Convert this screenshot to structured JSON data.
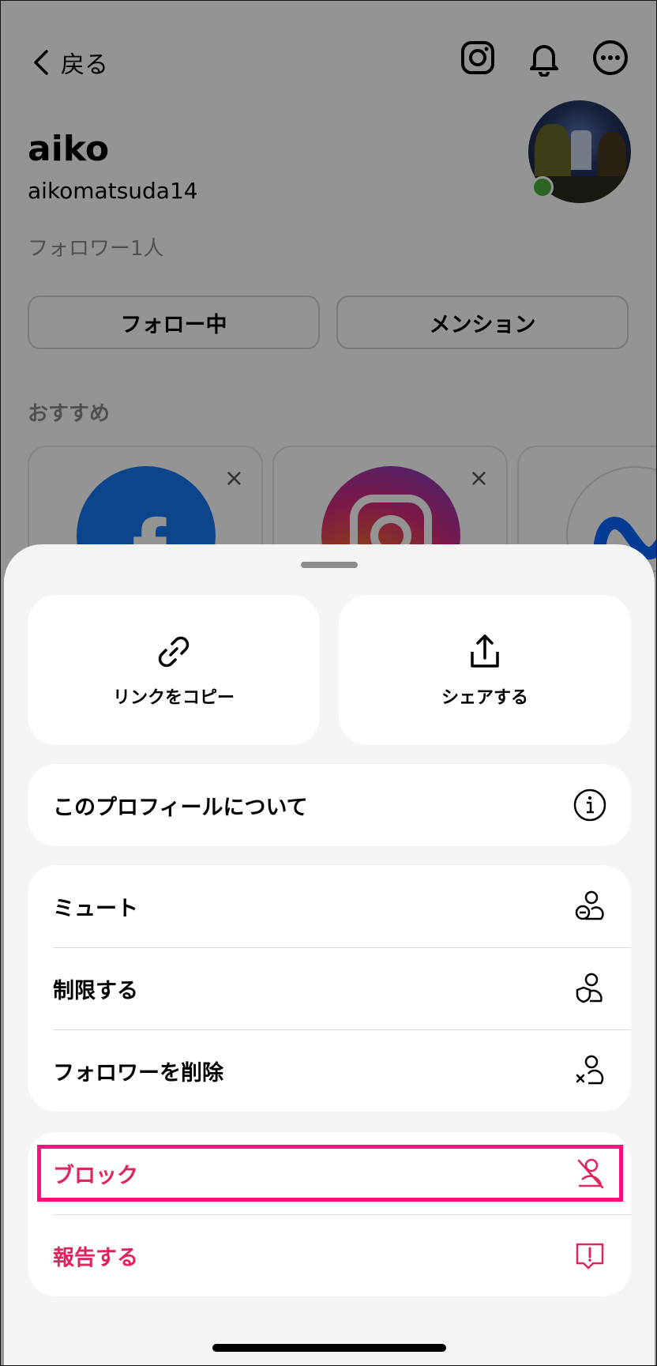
{
  "header": {
    "back_label": "戻る"
  },
  "profile": {
    "display_name": "aiko",
    "username": "aikomatsuda14",
    "followers": "フォロワー1人",
    "following_button": "フォロー中",
    "mention_button": "メンション",
    "online_status_color": "#4caf3a"
  },
  "suggestions": {
    "title": "おすすめ",
    "items": [
      {
        "icon": "facebook-logo",
        "dismiss": "×"
      },
      {
        "icon": "instagram-logo",
        "dismiss": "×"
      },
      {
        "icon": "meta-logo"
      }
    ]
  },
  "sheet": {
    "copy_link": "リンクをコピー",
    "share": "シェアする",
    "about": "このプロフィールについて",
    "mute": "ミュート",
    "restrict": "制限する",
    "remove_follower": "フォロワーを削除",
    "block": "ブロック",
    "report": "報告する",
    "danger_color": "#e0245e",
    "highlight_color": "#ff0f7b"
  }
}
